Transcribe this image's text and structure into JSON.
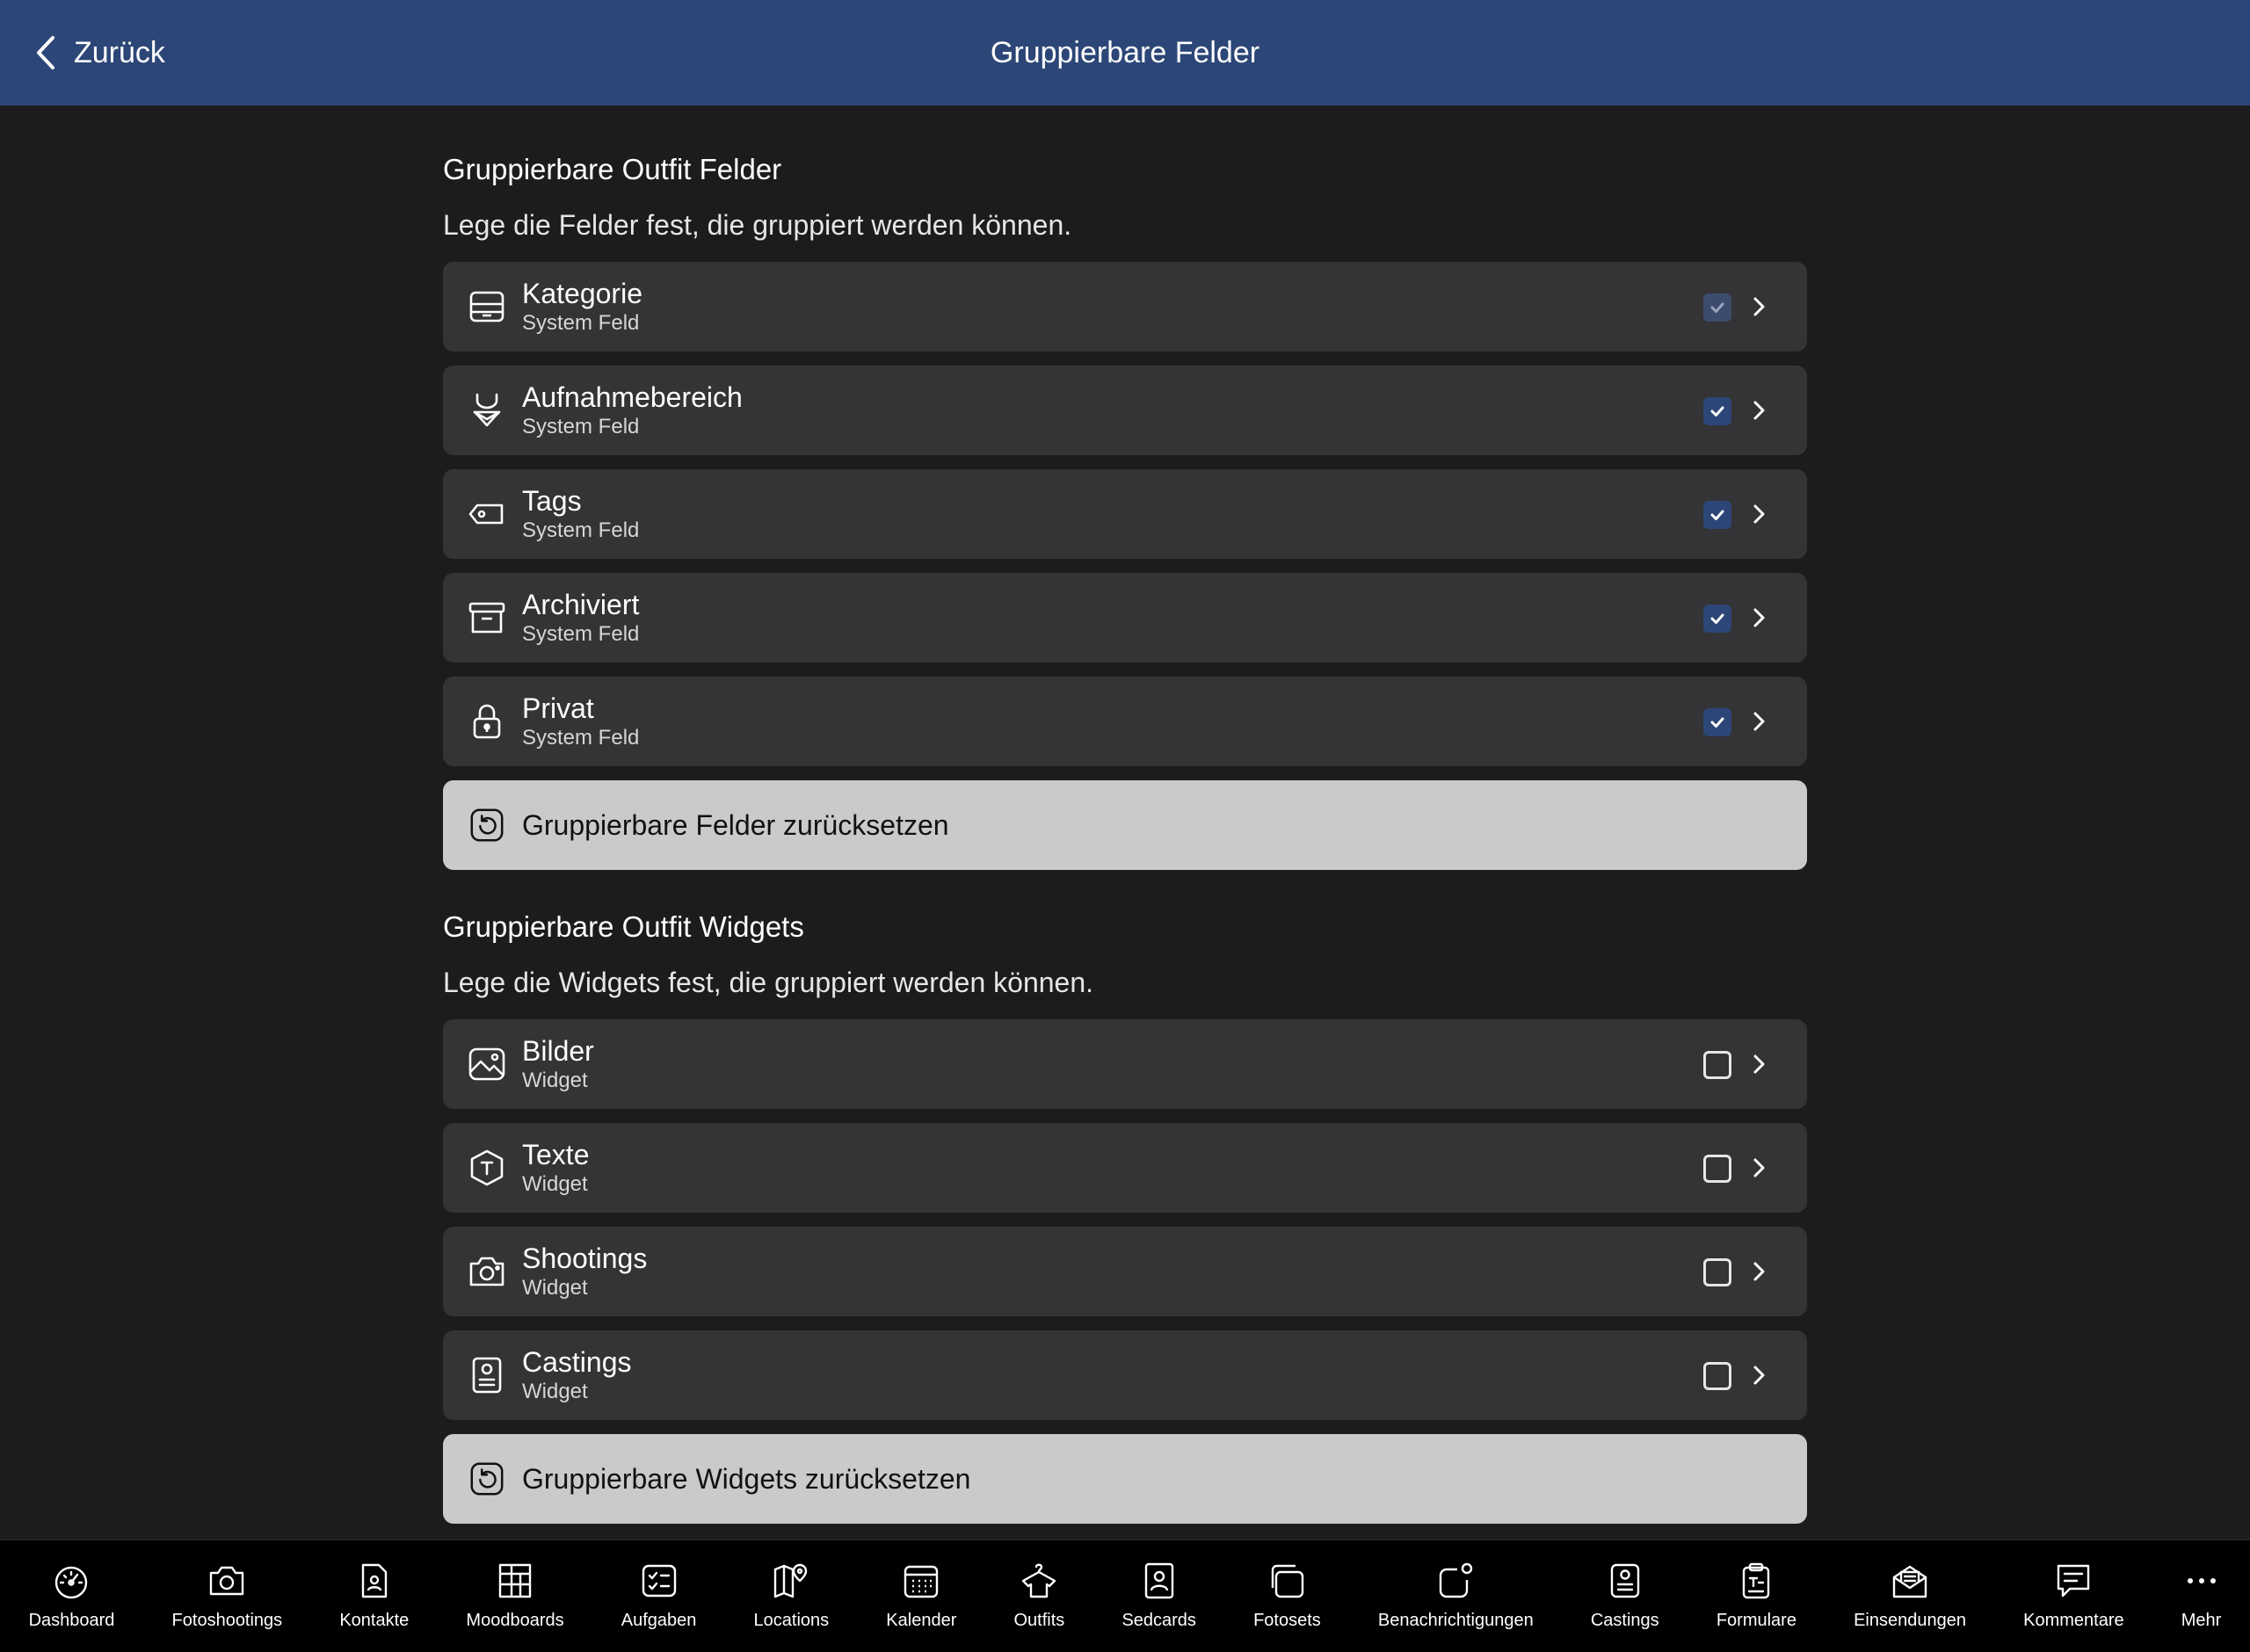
{
  "navbar": {
    "back_label": "Zurück",
    "title": "Gruppierbare Felder"
  },
  "fields_section": {
    "title": "Gruppierbare Outfit Felder",
    "description": "Lege die Felder fest, die gruppiert werden können.",
    "items": [
      {
        "title": "Kategorie",
        "subtitle": "System Feld",
        "icon": "tray-icon",
        "checked": true
      },
      {
        "title": "Aufnahmebereich",
        "subtitle": "System Feld",
        "icon": "swimwear-icon",
        "checked": true
      },
      {
        "title": "Tags",
        "subtitle": "System Feld",
        "icon": "tag-icon",
        "checked": true
      },
      {
        "title": "Archiviert",
        "subtitle": "System Feld",
        "icon": "archive-icon",
        "checked": true
      },
      {
        "title": "Privat",
        "subtitle": "System Feld",
        "icon": "lock-icon",
        "checked": true
      }
    ],
    "reset_label": "Gruppierbare Felder zurücksetzen"
  },
  "widgets_section": {
    "title": "Gruppierbare Outfit Widgets",
    "description": "Lege die Widgets fest, die gruppiert werden können.",
    "items": [
      {
        "title": "Bilder",
        "subtitle": "Widget",
        "icon": "image-icon",
        "checked": false
      },
      {
        "title": "Texte",
        "subtitle": "Widget",
        "icon": "text-badge-icon",
        "checked": false
      },
      {
        "title": "Shootings",
        "subtitle": "Widget",
        "icon": "camera-icon",
        "checked": false
      },
      {
        "title": "Castings",
        "subtitle": "Widget",
        "icon": "id-card-icon",
        "checked": false
      }
    ],
    "reset_label": "Gruppierbare Widgets zurücksetzen"
  },
  "tabbar": {
    "items": [
      {
        "label": "Dashboard",
        "icon": "gauge-icon"
      },
      {
        "label": "Fotoshootings",
        "icon": "camera-icon"
      },
      {
        "label": "Kontakte",
        "icon": "contact-icon"
      },
      {
        "label": "Moodboards",
        "icon": "moodboard-icon"
      },
      {
        "label": "Aufgaben",
        "icon": "checklist-icon"
      },
      {
        "label": "Locations",
        "icon": "map-icon"
      },
      {
        "label": "Kalender",
        "icon": "calendar-icon"
      },
      {
        "label": "Outfits",
        "icon": "hanger-shirt-icon"
      },
      {
        "label": "Sedcards",
        "icon": "sedcard-icon"
      },
      {
        "label": "Fotosets",
        "icon": "photoset-icon"
      },
      {
        "label": "Benachrichtigungen",
        "icon": "notification-icon"
      },
      {
        "label": "Castings",
        "icon": "id-card-icon"
      },
      {
        "label": "Formulare",
        "icon": "clipboard-icon"
      },
      {
        "label": "Einsendungen",
        "icon": "envelope-open-icon"
      },
      {
        "label": "Kommentare",
        "icon": "comment-icon"
      },
      {
        "label": "Mehr",
        "icon": "more-icon"
      }
    ]
  },
  "colors": {
    "navbar_bg": "#2c4677",
    "page_bg": "#1c1c1e",
    "row_bg": "#343436",
    "reset_bg": "#cacaca",
    "check_on": "#2c4677"
  }
}
